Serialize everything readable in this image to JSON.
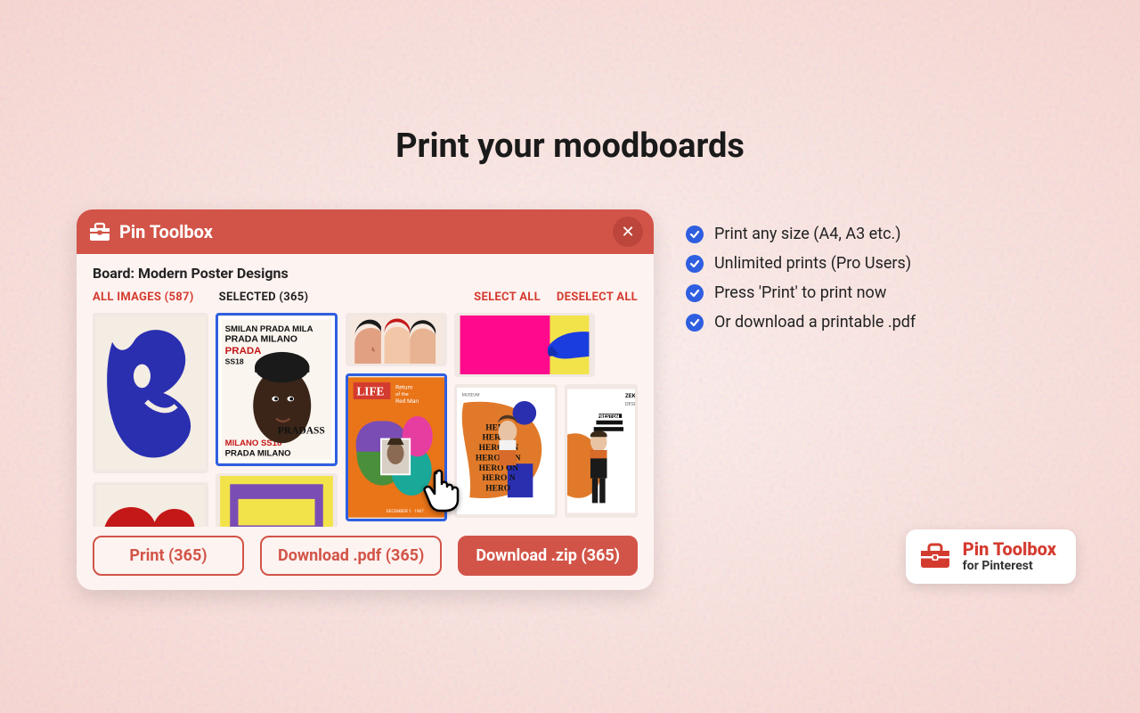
{
  "page_title": "Print your moodboards",
  "card": {
    "app_title": "Pin Toolbox",
    "close_glyph": "✕",
    "board_label": "Board: Modern Poster Designs",
    "filters": {
      "all_label": "ALL IMAGES (587)",
      "selected_label": "SELECTED (365)",
      "select_all": "SELECT ALL",
      "deselect_all": "DESELECT ALL"
    },
    "buttons": {
      "print": "Print (365)",
      "download_pdf": "Download .pdf (365)",
      "download_zip": "Download .zip (365)"
    },
    "thumbs": {
      "life_title": "LIFE",
      "life_subtitle": "Return of the Red Man"
    }
  },
  "features": [
    "Print any size (A4, A3 etc.)",
    "Unlimited prints (Pro Users)",
    "Press 'Print' to print now",
    "Or download a printable .pdf"
  ],
  "brand": {
    "line1": "Pin Toolbox",
    "line2": "for Pinterest"
  }
}
